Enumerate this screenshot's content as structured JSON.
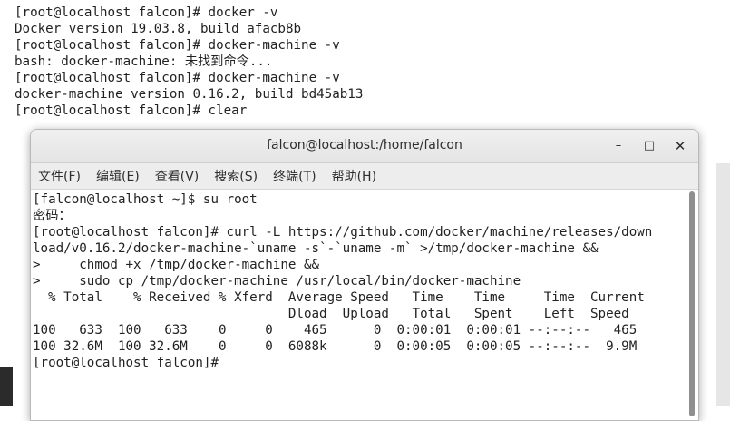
{
  "background_terminal": {
    "lines": [
      "[root@localhost falcon]# docker -v",
      "Docker version 19.03.8, build afacb8b",
      "[root@localhost falcon]# docker-machine -v",
      "bash: docker-machine: 未找到命令...",
      "[root@localhost falcon]# docker-machine -v",
      "docker-machine version 0.16.2, build bd45ab13",
      "[root@localhost falcon]# clear"
    ]
  },
  "window": {
    "title": "falcon@localhost:/home/falcon",
    "controls": {
      "minimize": "–",
      "maximize": "□",
      "close": "✕"
    },
    "menu": [
      "文件(F)",
      "编辑(E)",
      "查看(V)",
      "搜索(S)",
      "终端(T)",
      "帮助(H)"
    ],
    "terminal_lines": [
      "[falcon@localhost ~]$ su root",
      "密码：",
      "[root@localhost falcon]# curl -L https://github.com/docker/machine/releases/down",
      "load/v0.16.2/docker-machine-`uname -s`-`uname -m` >/tmp/docker-machine &&",
      ">     chmod +x /tmp/docker-machine &&",
      ">     sudo cp /tmp/docker-machine /usr/local/bin/docker-machine",
      "  % Total    % Received % Xferd  Average Speed   Time    Time     Time  Current",
      "                                 Dload  Upload   Total   Spent    Left  Speed",
      "100   633  100   633    0     0    465      0  0:00:01  0:00:01 --:--:--   465",
      "100 32.6M  100 32.6M    0     0  6088k      0  0:00:05  0:00:05 --:--:--  9.9M",
      "[root@localhost falcon]# "
    ]
  }
}
